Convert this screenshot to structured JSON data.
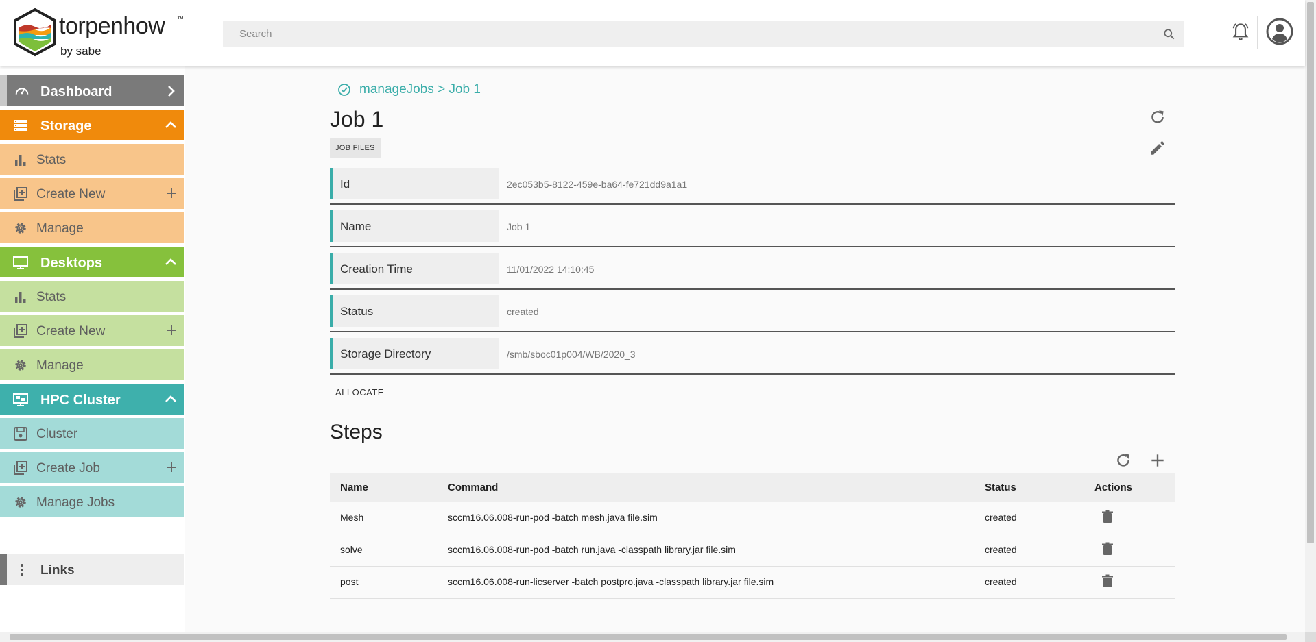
{
  "header": {
    "brand_name": "torpenhow",
    "brand_tm": "™",
    "brand_sub": "by sabe",
    "search_placeholder": "Search",
    "search_value": ""
  },
  "sidebar": {
    "dashboard": {
      "label": "Dashboard",
      "color": "#7a7a7a"
    },
    "storage": {
      "label": "Storage",
      "color": "#f08a0c",
      "sub_color": "#f8c58a",
      "items": [
        {
          "label": "Stats",
          "icon": "bar-chart-icon"
        },
        {
          "label": "Create New",
          "icon": "add-box-icon",
          "plus": true
        },
        {
          "label": "Manage",
          "icon": "gear-icon"
        }
      ]
    },
    "desktops": {
      "label": "Desktops",
      "color": "#86c13c",
      "sub_color": "#c5e09f",
      "items": [
        {
          "label": "Stats",
          "icon": "bar-chart-icon"
        },
        {
          "label": "Create New",
          "icon": "add-box-icon",
          "plus": true
        },
        {
          "label": "Manage",
          "icon": "gear-icon"
        }
      ]
    },
    "hpc": {
      "label": "HPC Cluster",
      "color": "#3eb0ac",
      "sub_color": "#a3dbd8",
      "items": [
        {
          "label": "Cluster",
          "icon": "save-icon"
        },
        {
          "label": "Create Job",
          "icon": "add-box-icon",
          "plus": true
        },
        {
          "label": "Manage Jobs",
          "icon": "gear-icon"
        }
      ]
    },
    "links": {
      "label": "Links"
    }
  },
  "main": {
    "breadcrumb": "manageJobs > Job 1",
    "title": "Job 1",
    "job_files_label": "JOB FILES",
    "fields": [
      {
        "label": "Id",
        "value": "2ec053b5-8122-459e-ba64-fe721dd9a1a1"
      },
      {
        "label": "Name",
        "value": "Job 1"
      },
      {
        "label": "Creation Time",
        "value": "11/01/2022 14:10:45"
      },
      {
        "label": "Status",
        "value": "created"
      },
      {
        "label": "Storage Directory",
        "value": "/smb/sboc01p004/WB/2020_3"
      }
    ],
    "allocate_label": "ALLOCATE",
    "steps_title": "Steps",
    "steps_table": {
      "columns": [
        "Name",
        "Command",
        "Status",
        "Actions"
      ],
      "rows": [
        {
          "name": "Mesh",
          "command": "sccm16.06.008-run-pod -batch mesh.java file.sim",
          "status": "created"
        },
        {
          "name": "solve",
          "command": "sccm16.06.008-run-pod -batch run.java -classpath library.jar file.sim",
          "status": "created"
        },
        {
          "name": "post",
          "command": "sccm16.06.008-run-licserver -batch postpro.java -classpath library.jar file.sim",
          "status": "created"
        }
      ]
    }
  },
  "colors": {
    "accent": "#3aada9"
  }
}
